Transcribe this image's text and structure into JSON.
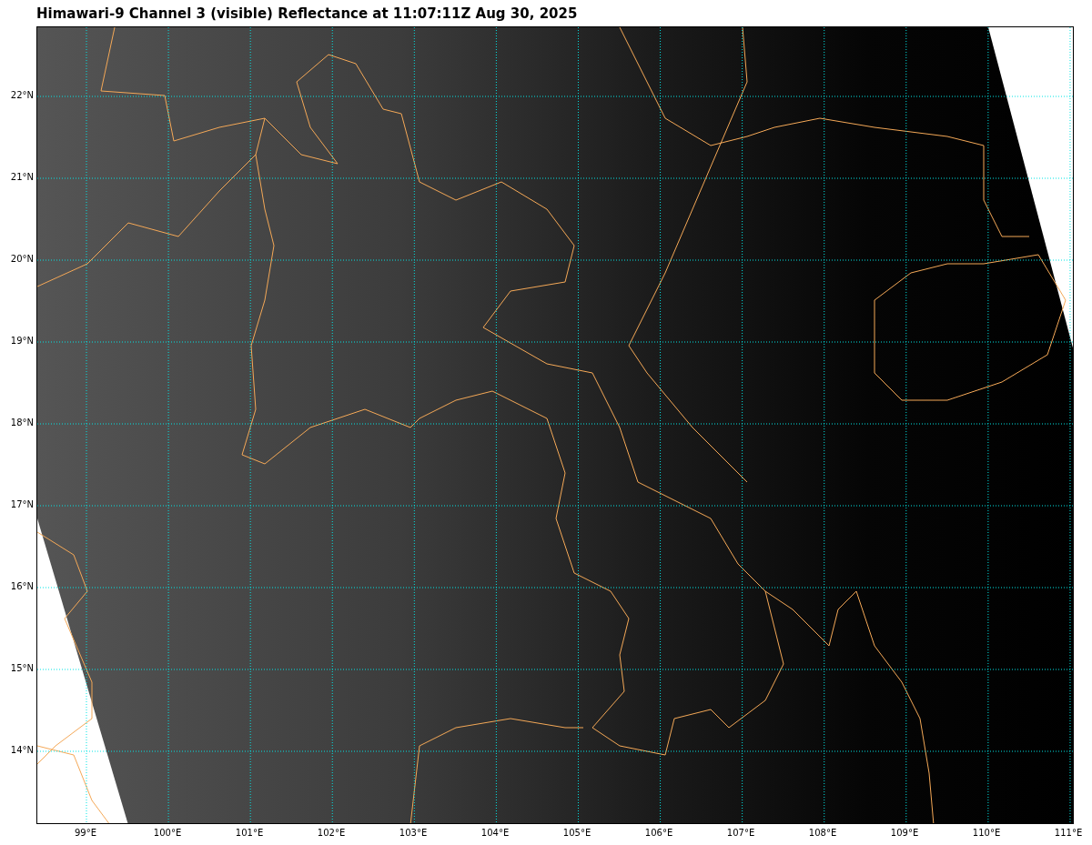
{
  "title": "Himawari-9 Channel 3 (visible) Reflectance at 11:07:11Z Aug 30, 2025",
  "map": {
    "lat_labels": [
      "22°N",
      "21°N",
      "20°N",
      "19°N",
      "18°N",
      "17°N",
      "16°N",
      "15°N",
      "14°N"
    ],
    "lon_labels": [
      "99°E",
      "100°E",
      "101°E",
      "102°E",
      "103°E",
      "104°E",
      "105°E",
      "106°E",
      "107°E",
      "108°E",
      "109°E",
      "110°E",
      "111°E"
    ]
  }
}
